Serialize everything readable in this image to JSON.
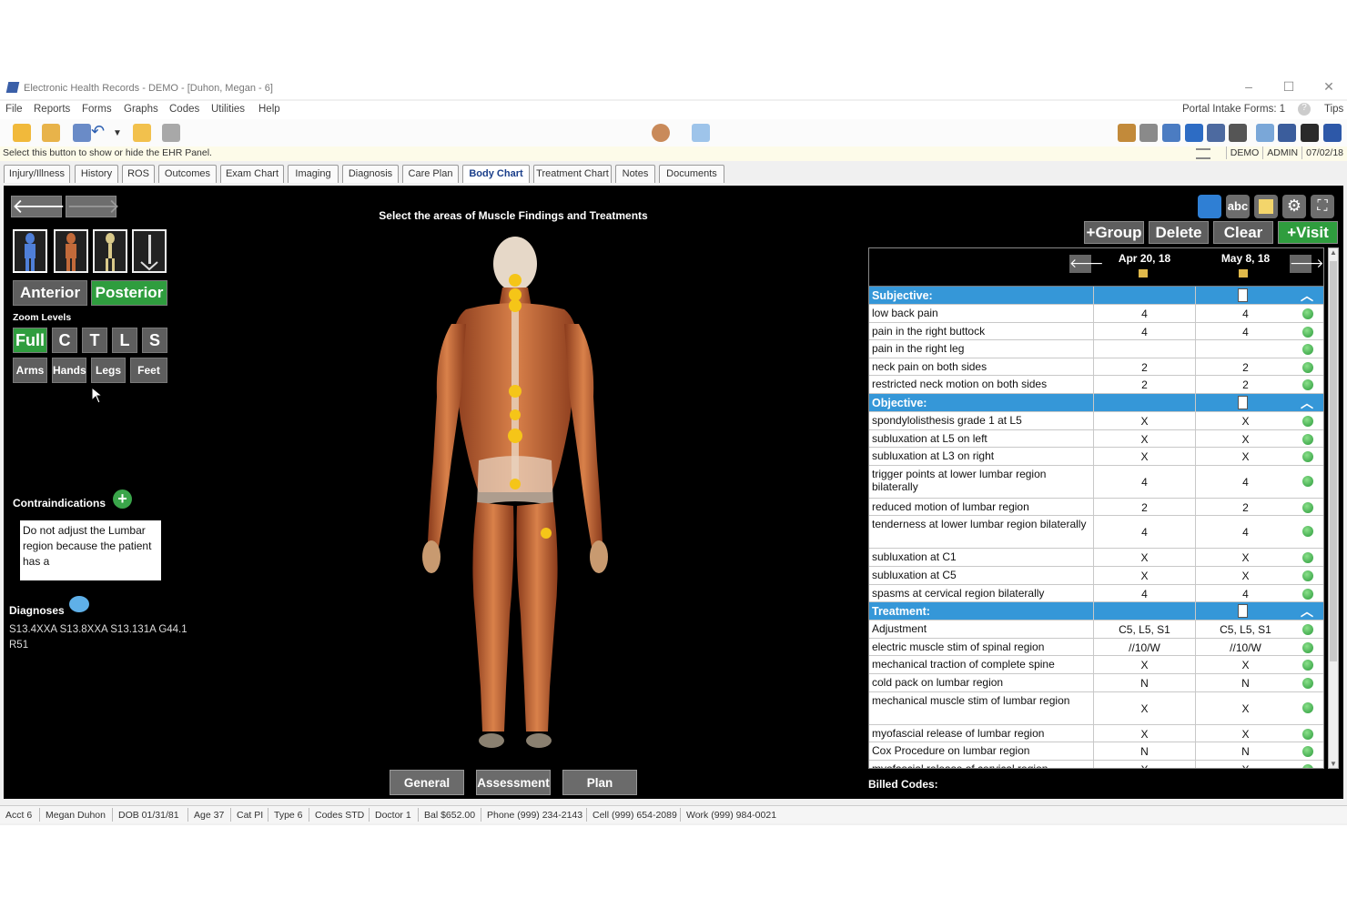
{
  "window": {
    "title": "Electronic Health Records - DEMO - [Duhon, Megan - 6]"
  },
  "menu": [
    "File",
    "Reports",
    "Forms",
    "Graphs",
    "Codes",
    "Utilities",
    "Help"
  ],
  "menu_right": {
    "portal": "Portal Intake Forms: 1",
    "tips": "Tips"
  },
  "hint": "Select this button to show or hide the EHR Panel.",
  "user": {
    "db": "DEMO",
    "user": "ADMIN",
    "date": "07/02/18"
  },
  "tabs": [
    "Injury/Illness",
    "History",
    "ROS",
    "Outcomes",
    "Exam Chart",
    "Imaging",
    "Diagnosis",
    "Care Plan",
    "Body Chart",
    "Treatment Chart",
    "Notes",
    "Documents"
  ],
  "active_tab": "Body Chart",
  "body_chart": {
    "title": "Select the areas of Muscle Findings and Treatments",
    "view_buttons": {
      "anterior": "Anterior",
      "posterior": "Posterior"
    },
    "zoom_label": "Zoom Levels",
    "zoom": [
      "Full",
      "C",
      "T",
      "L",
      "S"
    ],
    "zoom2": [
      "Arms",
      "Hands",
      "Legs",
      "Feet"
    ],
    "contraindications_label": "Contraindications",
    "contraindications_text": "Do not adjust the Lumbar region because the patient has a",
    "diagnoses_label": "Diagnoses",
    "diagnoses_codes": "S13.4XXA S13.8XXA S13.131A G44.1 R51",
    "bottom_buttons": [
      "General",
      "Assessment",
      "Plan"
    ],
    "billed_codes_label": "Billed Codes:"
  },
  "grid_toolbar": {
    "abc": "abc",
    "group": "+Group",
    "delete": "Delete",
    "clear": "Clear",
    "visit": "+Visit"
  },
  "grid": {
    "dates": [
      "Apr 20, 18",
      "May 8, 18"
    ],
    "sections": [
      {
        "name": "Subjective:",
        "rows": [
          {
            "label": "low back pain",
            "v1": "4",
            "v2": "4"
          },
          {
            "label": "pain in the right buttock",
            "v1": "4",
            "v2": "4"
          },
          {
            "label": "pain in the right leg",
            "v1": "",
            "v2": ""
          },
          {
            "label": "neck pain on both sides",
            "v1": "2",
            "v2": "2"
          },
          {
            "label": "restricted neck motion on both sides",
            "v1": "2",
            "v2": "2"
          }
        ]
      },
      {
        "name": "Objective:",
        "rows": [
          {
            "label": "spondylolisthesis grade 1 at L5",
            "v1": "X",
            "v2": "X"
          },
          {
            "label": "subluxation at L5 on left",
            "v1": "X",
            "v2": "X"
          },
          {
            "label": "subluxation at L3 on right",
            "v1": "X",
            "v2": "X"
          },
          {
            "label": "trigger points at lower lumbar region bilaterally",
            "v1": "4",
            "v2": "4"
          },
          {
            "label": "reduced motion of lumbar region",
            "v1": "2",
            "v2": "2"
          },
          {
            "label": "tenderness at lower lumbar region bilaterally",
            "v1": "4",
            "v2": "4"
          },
          {
            "label": "subluxation at C1",
            "v1": "X",
            "v2": "X"
          },
          {
            "label": "subluxation at C5",
            "v1": "X",
            "v2": "X"
          },
          {
            "label": "spasms at cervical region bilaterally",
            "v1": "4",
            "v2": "4"
          }
        ]
      },
      {
        "name": "Treatment:",
        "rows": [
          {
            "label": "Adjustment",
            "v1": "C5, L5, S1",
            "v2": "C5, L5, S1"
          },
          {
            "label": "electric muscle stim of spinal region",
            "v1": "//10/W",
            "v2": "//10/W"
          },
          {
            "label": "mechanical traction of complete spine",
            "v1": "X",
            "v2": "X"
          },
          {
            "label": "cold pack on lumbar region",
            "v1": "N",
            "v2": "N"
          },
          {
            "label": "mechanical muscle stim of lumbar region",
            "v1": "X",
            "v2": "X"
          },
          {
            "label": "myofascial release of lumbar region",
            "v1": "X",
            "v2": "X"
          },
          {
            "label": "Cox Procedure on lumbar region",
            "v1": "N",
            "v2": "N"
          },
          {
            "label": "myofascial release of cervical region",
            "v1": "X",
            "v2": "X"
          }
        ]
      }
    ]
  },
  "status_bar": [
    "Acct 6",
    "Megan Duhon",
    "DOB 01/31/81",
    "Age 37",
    "Cat PI",
    "Type 6",
    "Codes STD",
    "Doctor 1",
    "Bal $652.00",
    "Phone (999) 234-2143",
    "Cell (999) 654-2089",
    "Work (999) 984-0021"
  ],
  "colors": {
    "section_blue": "#3597d8",
    "active_green": "#2f9d3e",
    "marker_yellow": "#f5c518",
    "panel_bg": "#000000"
  }
}
